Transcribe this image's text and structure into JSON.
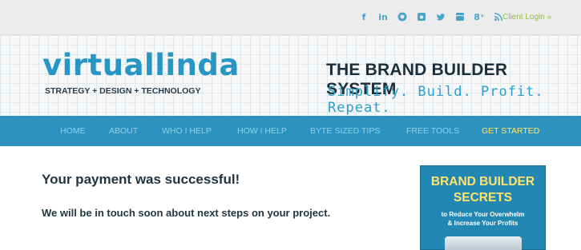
{
  "social": {
    "icons": [
      "facebook-icon",
      "linkedin-icon",
      "pinterest-icon",
      "instagram-icon",
      "twitter-icon",
      "youtube-icon",
      "google-plus-icon",
      "rss-icon"
    ],
    "color": "#4aa3c9",
    "client_login": "Client Login »"
  },
  "header": {
    "logo_name": "virtuallinda",
    "logo_tagline": "STRATEGY + DESIGN + TECHNOLOGY",
    "brand_title": "THE BRAND BUILDER SYSTEM",
    "brand_subtitle": "Simplify. Build. Profit. Repeat."
  },
  "nav": {
    "items": [
      {
        "label": "HOME"
      },
      {
        "label": "ABOUT"
      },
      {
        "label": "WHO I HELP"
      },
      {
        "label": "HOW I HELP"
      },
      {
        "label": "BYTE SIZED TIPS"
      },
      {
        "label": "FREE TOOLS"
      },
      {
        "label": "GET STARTED"
      }
    ],
    "background": "#2c93c0",
    "active_color": "#ffe36a"
  },
  "main": {
    "heading": "Your payment was successful!",
    "message": "We will be in touch soon about next steps on your project."
  },
  "promo": {
    "title_line1": "BRAND BUILDER",
    "title_line2": "SECRETS",
    "sub_line1": "to Reduce Your Overwhelm",
    "sub_line2": "& Increase Your Profits"
  }
}
